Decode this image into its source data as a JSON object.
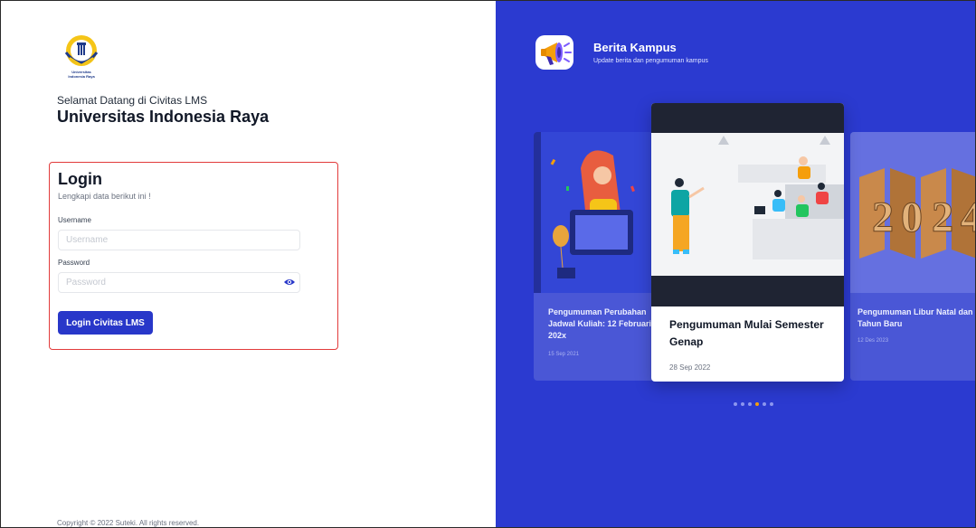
{
  "brand": {
    "logo_text": "Universitas Indonesia Raya"
  },
  "left": {
    "welcome": "Selamat Datang di Civitas LMS",
    "university": "Universitas Indonesia Raya",
    "copyright": "Copyright © 2022 Suteki. All rights reserved."
  },
  "login": {
    "title": "Login",
    "subtitle": "Lengkapi data berikut ini !",
    "username_label": "Username",
    "username_placeholder": "Username",
    "username_value": "",
    "password_label": "Password",
    "password_placeholder": "Password",
    "password_value": "",
    "submit_label": "Login Civitas LMS",
    "highlight_color": "#e23b3b",
    "button_color": "#2837c9"
  },
  "news": {
    "title": "Berita Kampus",
    "subtitle": "Update berita dan pengumuman kampus",
    "panel_color": "#2b3ad0",
    "cards": [
      {
        "title_line1": "Pengumuman Perubahan",
        "title_line2": "Jadwal Kuliah: 12 Februari",
        "title_line3": "202x",
        "date": "15 Sep 2021"
      },
      {
        "title": "Pengumuman Mulai Semester Genap",
        "date": "28 Sep 2022"
      },
      {
        "title_line1": "Pengumuman Libur Natal dan",
        "title_line2": "Tahun Baru",
        "date": "12 Des 2023"
      }
    ],
    "carousel_total": 6,
    "carousel_active_index": 3,
    "active_dot_color": "#f59e0b"
  }
}
